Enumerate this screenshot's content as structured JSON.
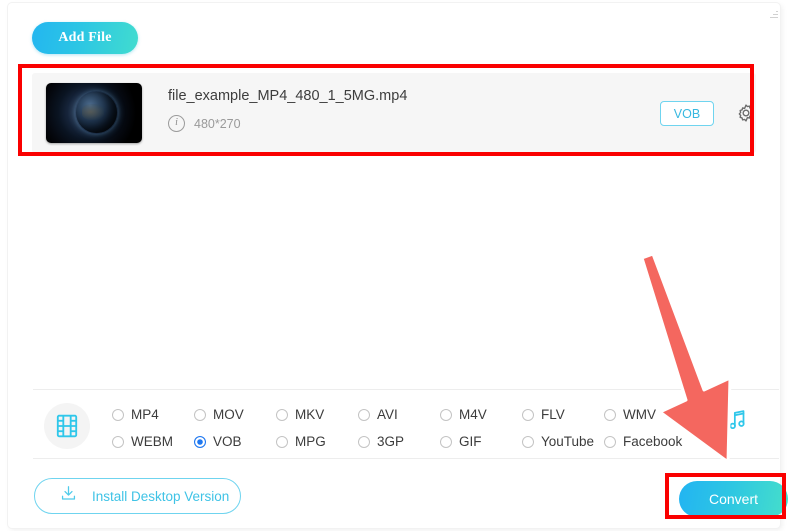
{
  "window": {
    "resize_handle": "resize-handle"
  },
  "toolbar": {
    "add_file_label": "Add File"
  },
  "file_row": {
    "thumbnail_alt": "video-thumbnail-earth",
    "name": "file_example_MP4_480_1_5MG.mp4",
    "info_glyph": "i",
    "resolution": "480*270",
    "output_format_tag": "VOB",
    "settings_icon": "gear-icon"
  },
  "format_bar": {
    "category_icon": "film-strip-icon",
    "audio_icon": "music-note-icon",
    "selected": "VOB",
    "options": [
      {
        "label": "MP4",
        "checked": false
      },
      {
        "label": "MOV",
        "checked": false
      },
      {
        "label": "MKV",
        "checked": false
      },
      {
        "label": "AVI",
        "checked": false
      },
      {
        "label": "M4V",
        "checked": false
      },
      {
        "label": "FLV",
        "checked": false
      },
      {
        "label": "WMV",
        "checked": false
      },
      {
        "label": "WEBM",
        "checked": false
      },
      {
        "label": "VOB",
        "checked": true
      },
      {
        "label": "MPG",
        "checked": false
      },
      {
        "label": "3GP",
        "checked": false
      },
      {
        "label": "GIF",
        "checked": false
      },
      {
        "label": "YouTube",
        "checked": false
      },
      {
        "label": "Facebook",
        "checked": false
      }
    ]
  },
  "footer": {
    "install_label": "Install Desktop Version",
    "install_icon": "download-icon",
    "convert_label": "Convert"
  },
  "annotations": {
    "highlight_color": "#fa0000",
    "arrow_color": "#f4675f",
    "highlight_file_row": "highlight-file-row",
    "highlight_convert": "highlight-convert-button",
    "arrow": "pointer-arrow-to-convert"
  },
  "colors": {
    "accent_start": "#22b4f2",
    "accent_end": "#46dfca",
    "radio_selected": "#1f78f0",
    "outline_cyan": "#6fd4ef"
  }
}
